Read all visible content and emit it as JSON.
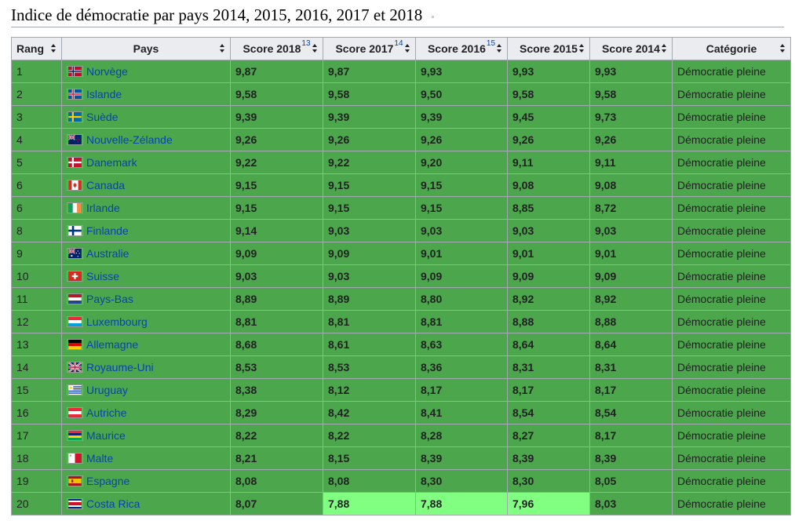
{
  "title": "Indice de démocratie par pays 2014, 2015, 2016, 2017 et 2018",
  "columns": [
    {
      "label": "Rang",
      "ref": ""
    },
    {
      "label": "Pays",
      "ref": ""
    },
    {
      "label": "Score 2018",
      "ref": "13"
    },
    {
      "label": "Score 2017",
      "ref": "14"
    },
    {
      "label": "Score 2016",
      "ref": "15"
    },
    {
      "label": "Score 2015",
      "ref": ""
    },
    {
      "label": "Score 2014",
      "ref": ""
    },
    {
      "label": "Catégorie",
      "ref": ""
    }
  ],
  "colors": {
    "full_democracy": "#4ca64c",
    "highlight": "#80ff80",
    "header_bg": "#eaecf0",
    "link": "#0645ad"
  },
  "rows": [
    {
      "rank": "1",
      "country": "Norvège",
      "flag": "norway-flag-icon",
      "s2018": "9,87",
      "s2017": "9,87",
      "s2016": "9,93",
      "s2015": "9,93",
      "s2014": "9,93",
      "category": "Démocratie pleine",
      "hi": []
    },
    {
      "rank": "2",
      "country": "Islande",
      "flag": "iceland-flag-icon",
      "s2018": "9,58",
      "s2017": "9,58",
      "s2016": "9,50",
      "s2015": "9,58",
      "s2014": "9,58",
      "category": "Démocratie pleine",
      "hi": []
    },
    {
      "rank": "3",
      "country": "Suède",
      "flag": "sweden-flag-icon",
      "s2018": "9,39",
      "s2017": "9,39",
      "s2016": "9,39",
      "s2015": "9,45",
      "s2014": "9,73",
      "category": "Démocratie pleine",
      "hi": []
    },
    {
      "rank": "4",
      "country": "Nouvelle-Zélande",
      "flag": "new-zealand-flag-icon",
      "s2018": "9,26",
      "s2017": "9,26",
      "s2016": "9,26",
      "s2015": "9,26",
      "s2014": "9,26",
      "category": "Démocratie pleine",
      "hi": []
    },
    {
      "rank": "5",
      "country": "Danemark",
      "flag": "denmark-flag-icon",
      "s2018": "9,22",
      "s2017": "9,22",
      "s2016": "9,20",
      "s2015": "9,11",
      "s2014": "9,11",
      "category": "Démocratie pleine",
      "hi": []
    },
    {
      "rank": "6",
      "country": "Canada",
      "flag": "canada-flag-icon",
      "s2018": "9,15",
      "s2017": "9,15",
      "s2016": "9,15",
      "s2015": "9,08",
      "s2014": "9,08",
      "category": "Démocratie pleine",
      "hi": []
    },
    {
      "rank": "6",
      "country": "Irlande",
      "flag": "ireland-flag-icon",
      "s2018": "9,15",
      "s2017": "9,15",
      "s2016": "9,15",
      "s2015": "8,85",
      "s2014": "8,72",
      "category": "Démocratie pleine",
      "hi": []
    },
    {
      "rank": "8",
      "country": "Finlande",
      "flag": "finland-flag-icon",
      "s2018": "9,14",
      "s2017": "9,03",
      "s2016": "9,03",
      "s2015": "9,03",
      "s2014": "9,03",
      "category": "Démocratie pleine",
      "hi": []
    },
    {
      "rank": "9",
      "country": "Australie",
      "flag": "australia-flag-icon",
      "s2018": "9,09",
      "s2017": "9,09",
      "s2016": "9,01",
      "s2015": "9,01",
      "s2014": "9,01",
      "category": "Démocratie pleine",
      "hi": []
    },
    {
      "rank": "10",
      "country": "Suisse",
      "flag": "switzerland-flag-icon",
      "s2018": "9,03",
      "s2017": "9,03",
      "s2016": "9,09",
      "s2015": "9,09",
      "s2014": "9,09",
      "category": "Démocratie pleine",
      "hi": []
    },
    {
      "rank": "11",
      "country": "Pays-Bas",
      "flag": "netherlands-flag-icon",
      "s2018": "8,89",
      "s2017": "8,89",
      "s2016": "8,80",
      "s2015": "8,92",
      "s2014": "8,92",
      "category": "Démocratie pleine",
      "hi": []
    },
    {
      "rank": "12",
      "country": "Luxembourg",
      "flag": "luxembourg-flag-icon",
      "s2018": "8,81",
      "s2017": "8,81",
      "s2016": "8,81",
      "s2015": "8,88",
      "s2014": "8,88",
      "category": "Démocratie pleine",
      "hi": []
    },
    {
      "rank": "13",
      "country": "Allemagne",
      "flag": "germany-flag-icon",
      "s2018": "8,68",
      "s2017": "8,61",
      "s2016": "8,63",
      "s2015": "8,64",
      "s2014": "8,64",
      "category": "Démocratie pleine",
      "hi": []
    },
    {
      "rank": "14",
      "country": "Royaume-Uni",
      "flag": "united-kingdom-flag-icon",
      "s2018": "8,53",
      "s2017": "8,53",
      "s2016": "8,36",
      "s2015": "8,31",
      "s2014": "8,31",
      "category": "Démocratie pleine",
      "hi": []
    },
    {
      "rank": "15",
      "country": "Uruguay",
      "flag": "uruguay-flag-icon",
      "s2018": "8,38",
      "s2017": "8,12",
      "s2016": "8,17",
      "s2015": "8,17",
      "s2014": "8,17",
      "category": "Démocratie pleine",
      "hi": []
    },
    {
      "rank": "16",
      "country": "Autriche",
      "flag": "austria-flag-icon",
      "s2018": "8,29",
      "s2017": "8,42",
      "s2016": "8,41",
      "s2015": "8,54",
      "s2014": "8,54",
      "category": "Démocratie pleine",
      "hi": []
    },
    {
      "rank": "17",
      "country": "Maurice",
      "flag": "mauritius-flag-icon",
      "s2018": "8,22",
      "s2017": "8,22",
      "s2016": "8,28",
      "s2015": "8,27",
      "s2014": "8,17",
      "category": "Démocratie pleine",
      "hi": []
    },
    {
      "rank": "18",
      "country": "Malte",
      "flag": "malta-flag-icon",
      "s2018": "8,21",
      "s2017": "8,15",
      "s2016": "8,39",
      "s2015": "8,39",
      "s2014": "8,39",
      "category": "Démocratie pleine",
      "hi": []
    },
    {
      "rank": "19",
      "country": "Espagne",
      "flag": "spain-flag-icon",
      "s2018": "8,08",
      "s2017": "8,08",
      "s2016": "8,30",
      "s2015": "8,30",
      "s2014": "8,05",
      "category": "Démocratie pleine",
      "hi": []
    },
    {
      "rank": "20",
      "country": "Costa Rica",
      "flag": "costa-rica-flag-icon",
      "s2018": "8,07",
      "s2017": "7,88",
      "s2016": "7,88",
      "s2015": "7,96",
      "s2014": "8,03",
      "category": "Démocratie pleine",
      "hi": [
        "s2017",
        "s2016",
        "s2015"
      ]
    }
  ]
}
